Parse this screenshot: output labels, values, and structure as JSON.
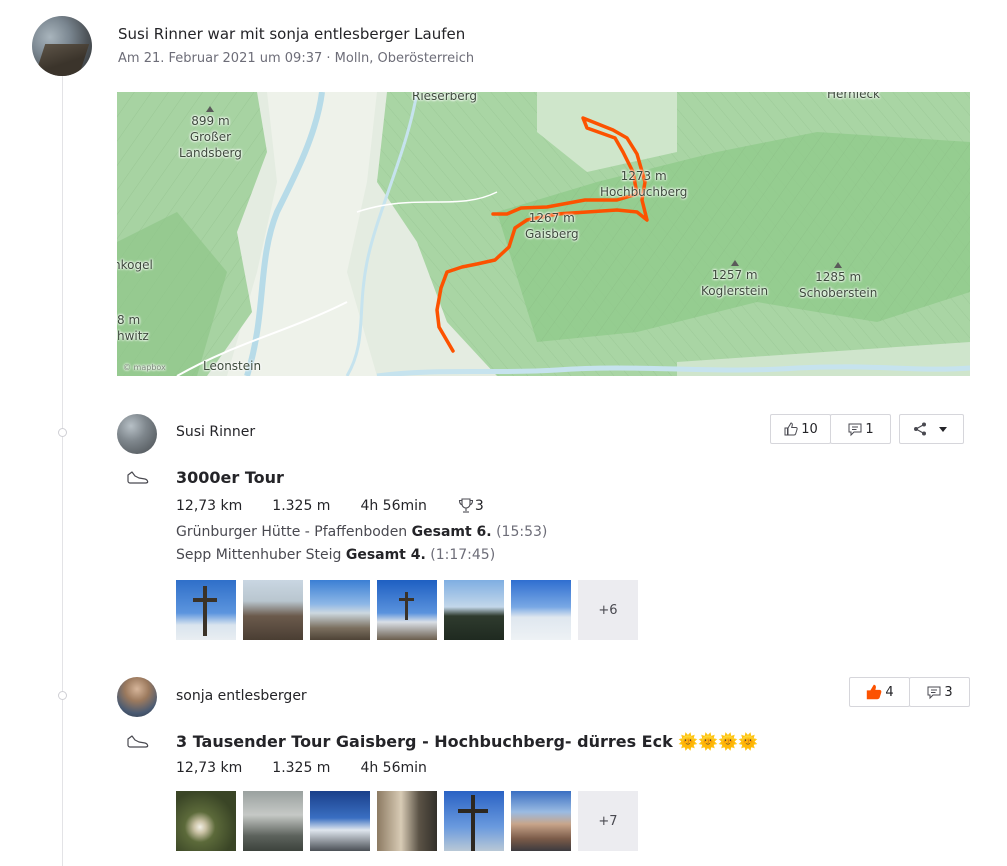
{
  "header": {
    "title": "Susi Rinner war mit sonja entlesberger Laufen",
    "subtitle": "Am 21. Februar 2021 um 09:37 · Molln, Oberösterreich"
  },
  "map": {
    "labels": {
      "rieserberg": "Rieserberg",
      "hernleck": "Hernleck",
      "landsberg_elev": "899 m",
      "landsberg_name1": "Großer",
      "landsberg_name2": "Landsberg",
      "hochbuchberg_elev": "1273 m",
      "hochbuchberg_name": "Hochbuchberg",
      "gaisberg_elev": "1267 m",
      "gaisberg_name": "Gaisberg",
      "koglerstein_elev": "1257 m",
      "koglerstein_name": "Koglerstein",
      "schoberstein_elev": "1285 m",
      "schoberstein_name": "Schoberstein",
      "kogel": "nkogel",
      "hwitz_elev": "8 m",
      "hwitz": "hwitz",
      "leonstein": "Leonstein",
      "attribution": "© mapbox"
    },
    "route_color": "#fc5200",
    "terrain_color": "#9ccd98"
  },
  "activities": [
    {
      "athlete": "Susi Rinner",
      "title": "3000er Tour",
      "distance": "12,73 km",
      "elevation": "1.325 m",
      "time": "4h 56min",
      "achievements": "3",
      "kudos": "10",
      "comments": "1",
      "segments": [
        {
          "name": "Grünburger Hütte - Pfaffenboden",
          "rank": "Gesamt 6.",
          "time": "(15:53)"
        },
        {
          "name": "Sepp Mittenhuber Steig",
          "rank": "Gesamt 4.",
          "time": "(1:17:45)"
        }
      ],
      "more_photos": "+6"
    },
    {
      "athlete": "sonja entlesberger",
      "title": "3 Tausender Tour Gaisberg - Hochbuchberg- dürres Eck",
      "title_emoji": "🌞🌞🌞🌞",
      "distance": "12,73 km",
      "elevation": "1.325 m",
      "time": "4h 56min",
      "kudos": "4",
      "comments": "3",
      "more_photos": "+7"
    }
  ],
  "icons": {
    "activity_type": "running-shoe-icon",
    "kudos": "thumbs-up-icon",
    "comment": "comment-icon",
    "share": "share-icon",
    "dropdown": "chevron-down-icon",
    "trophy": "trophy-icon"
  }
}
